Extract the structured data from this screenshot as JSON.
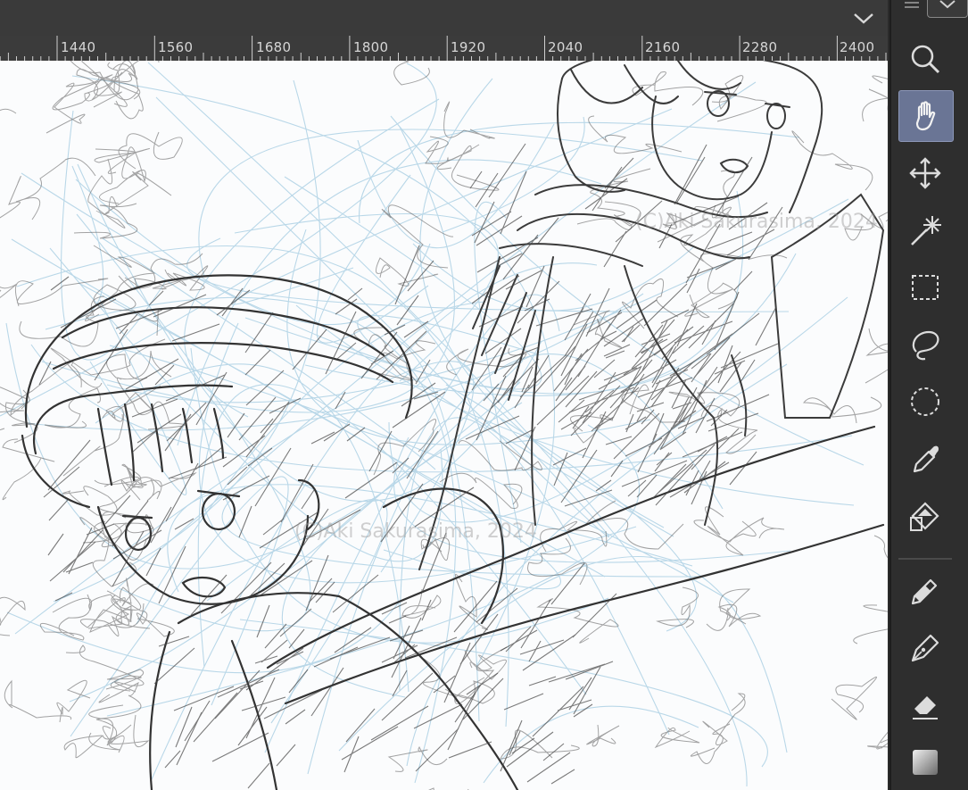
{
  "ruler": {
    "marks": [
      "1440",
      "1560",
      "1680",
      "1800",
      "1920",
      "2040",
      "2160",
      "2280",
      "2400"
    ]
  },
  "canvas": {
    "watermark_1": "(C)Aki Sakurasima, 2024",
    "watermark_2": "(C)Aki Sakurasima, 2024"
  },
  "toolbar": {
    "tools": [
      {
        "name": "zoom-tool",
        "icon": "magnifier-icon",
        "active": false
      },
      {
        "name": "hand-tool",
        "icon": "hand-icon",
        "active": true
      },
      {
        "name": "move-tool",
        "icon": "move-arrows-icon",
        "active": false
      },
      {
        "name": "operation-tool",
        "icon": "magic-wand-icon",
        "active": false
      },
      {
        "name": "rect-selection-tool",
        "icon": "rectangle-selection-icon",
        "active": false
      },
      {
        "name": "lasso-selection-tool",
        "icon": "lasso-icon",
        "active": false
      },
      {
        "name": "ellipse-selection-tool",
        "icon": "ellipse-selection-icon",
        "active": false
      },
      {
        "name": "eyedropper-tool",
        "icon": "eyedropper-icon",
        "active": false
      },
      {
        "name": "fill-tool",
        "icon": "paint-bucket-icon",
        "active": false
      },
      {
        "name": "pencil-tool",
        "icon": "pencil-icon",
        "active": false
      },
      {
        "name": "pen-tool",
        "icon": "pen-nib-icon",
        "active": false
      },
      {
        "name": "eraser-tool",
        "icon": "eraser-icon",
        "active": false
      },
      {
        "name": "gradient-tool",
        "icon": "gradient-icon",
        "active": false
      }
    ]
  },
  "colors": {
    "accent_active_tool": "#6a7595",
    "panel_bg": "#2e2e2e",
    "canvas_bg": "#fbfcfd",
    "sketch_stroke": "#3a3a3a",
    "guide_stroke": "#9cc6de"
  }
}
